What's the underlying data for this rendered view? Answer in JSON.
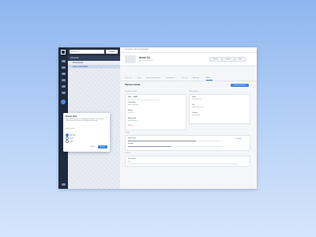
{
  "nav": {
    "search_placeholder": "Search...",
    "new_label": "+ New",
    "section_title": "Accounts",
    "items": [
      {
        "label": "All accounts"
      },
      {
        "label": "Acme Corporation"
      }
    ]
  },
  "breadcrumb": "Accounts / Acme Corporation",
  "header": {
    "title": "Acme Co",
    "subtitle": "Active · Enterprise",
    "actions": [
      "Share",
      "Export",
      "Edit"
    ]
  },
  "tabs": [
    "Overview",
    "Users",
    "Roles & permissions",
    "Integrations",
    "Security",
    "Audit log",
    "Billing"
  ],
  "active_tab": "Billing",
  "billing": {
    "section_title": "Payment details",
    "primary_button": "Update payment",
    "left_title": "Payment method",
    "right_title": "Billing address",
    "left_card": {
      "heading": "Visa ···· 4242",
      "fields": [
        {
          "label": "Card holder",
          "value": "Acme Corporation"
        },
        {
          "label": "Expires",
          "value": "08 / 2026"
        },
        {
          "label": "Billing email",
          "value": "billing@acme.co"
        }
      ],
      "remove_link": "Remove"
    },
    "right_card": {
      "fields": [
        {
          "label": "Street",
          "value": "1200 Market St"
        },
        {
          "label": "City",
          "value": "San Francisco, CA"
        },
        {
          "label": "Country",
          "value": "United States"
        }
      ]
    },
    "usage_title": "Usage",
    "usage": {
      "rows": [
        {
          "label": "Seats used",
          "value": 0.72
        },
        {
          "label": "Storage",
          "value": 0.45
        }
      ],
      "manage": "Manage"
    },
    "invoice_title": "Invoices",
    "invoice": {
      "label": "Last invoice",
      "value": "Paid"
    }
  },
  "modal": {
    "title": "Export data",
    "text": "Choose the format for the exported account data. The file will be generated and sent to your email address when ready.",
    "options": [
      {
        "label": "CSV file",
        "selected": true
      },
      {
        "label": "Excel",
        "selected": false
      },
      {
        "label": "PDF",
        "selected": false
      }
    ],
    "options_label": "Select format",
    "cancel": "Cancel",
    "confirm": "Export"
  }
}
